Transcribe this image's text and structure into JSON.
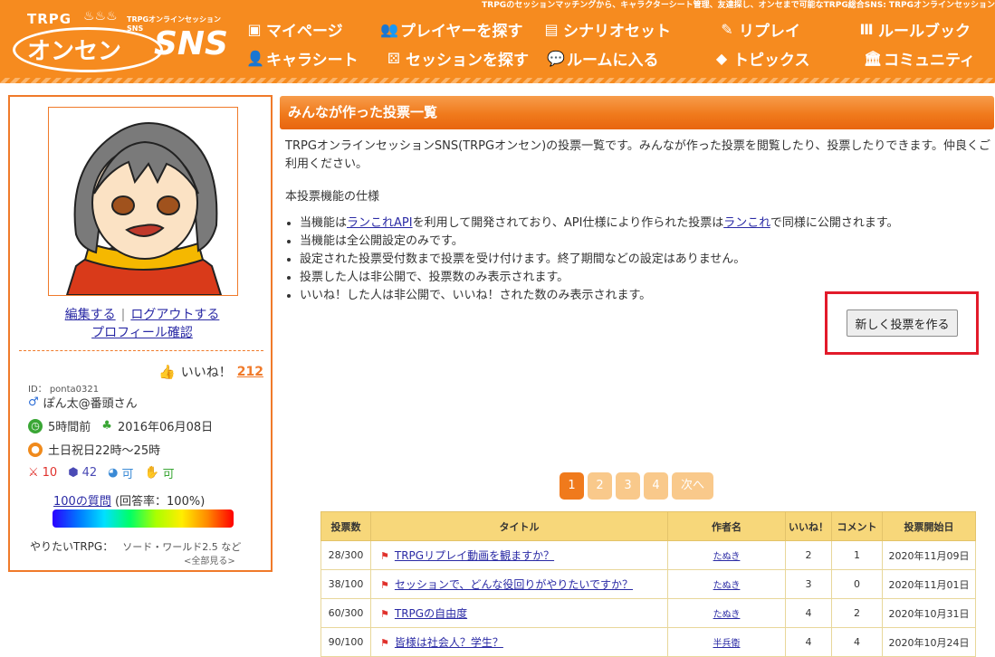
{
  "header": {
    "tagline": "TRPGのセッションマッチングから、キャラクターシート管理、友達探し、オンセまで可能なTRPG総合SNS: TRPGオンラインセッション",
    "logo": {
      "trpg": "TRPG",
      "sub": "TRPGオンラインセッションSNS",
      "main": "オンセン",
      "sns": "SNS"
    },
    "nav": [
      {
        "label": "マイページ",
        "icon": "mypage-icon"
      },
      {
        "label": "プレイヤーを探す",
        "icon": "players-icon"
      },
      {
        "label": "シナリオセット",
        "icon": "scenario-icon"
      },
      {
        "label": "リプレイ",
        "icon": "replay-icon"
      },
      {
        "label": "ルールブック",
        "icon": "rulebook-icon"
      },
      {
        "label": "キャラシート",
        "icon": "character-icon"
      },
      {
        "label": "セッションを探す",
        "icon": "dice-icon"
      },
      {
        "label": "ルームに入る",
        "icon": "chat-icon"
      },
      {
        "label": "トピックス",
        "icon": "tag-icon"
      },
      {
        "label": "コミュニティ",
        "icon": "building-icon"
      }
    ]
  },
  "sidebar": {
    "edit": "編集する",
    "logout": "ログアウトする",
    "profile": "プロフィール確認",
    "separator": "|",
    "likes_label": "いいね！",
    "likes_count": "212",
    "id_label": "ID： ponta0321",
    "name": "ぽん太@番頭さん",
    "last_login": "5時間前",
    "registered": "2016年06月08日",
    "active_time": "土日祝日22時～25時",
    "stats": {
      "sword": "10",
      "dice": "42",
      "mind": "可",
      "hand": "可"
    },
    "questions_link": "100の質問",
    "questions_rate": "(回答率：100%)",
    "want_label": "やりたいTRPG：",
    "want_value": "ソード・ワールド2.5 など",
    "want_all": "<全部見る>"
  },
  "main": {
    "title": "みんなが作った投票一覧",
    "description": "TRPGオンラインセッションSNS(TRPGオンセン)の投票一覧です。みんなが作った投票を閲覧したり、投票したりできます。仲良くご利用ください。",
    "spec_title": "本投票機能の仕様",
    "spec": [
      {
        "pre": "当機能は",
        "link": "ランこれAPI",
        "mid": "を利用して開発されており、API仕様により作られた投票は",
        "link2": "ランこれ",
        "post": "で同様に公開されます。"
      },
      {
        "text": "当機能は全公開設定のみです。"
      },
      {
        "text": "設定された投票受付数まで投票を受け付けます。終了期間などの設定はありません。"
      },
      {
        "text": "投票した人は非公開で、投票数のみ表示されます。"
      },
      {
        "text": "いいね！した人は非公開で、いいね！された数のみ表示されます。"
      }
    ],
    "new_button": "新しく投票を作る",
    "pagination": [
      "1",
      "2",
      "3",
      "4",
      "次へ"
    ]
  },
  "table": {
    "headers": [
      "投票数",
      "タイトル",
      "作者名",
      "いいね！",
      "コメント",
      "投票開始日"
    ],
    "rows": [
      {
        "votes": "28/300",
        "title": "TRPGリプレイ動画を観ますか？",
        "author": "たぬき",
        "likes": "2",
        "comments": "1",
        "date": "2020年11月09日"
      },
      {
        "votes": "38/100",
        "title": "セッションで、どんな役回りがやりたいですか？",
        "author": "たぬき",
        "likes": "3",
        "comments": "0",
        "date": "2020年11月01日"
      },
      {
        "votes": "60/300",
        "title": "TRPGの自由度",
        "author": "たぬき",
        "likes": "4",
        "comments": "2",
        "date": "2020年10月31日"
      },
      {
        "votes": "90/100",
        "title": "皆様は社会人？学生？",
        "author": "半兵衛",
        "likes": "4",
        "comments": "4",
        "date": "2020年10月24日"
      }
    ]
  },
  "colors": {
    "brand": "#f68b1f",
    "accent": "#f07a1c",
    "highlight": "#e21a2a",
    "table_header": "#f7d77a"
  }
}
